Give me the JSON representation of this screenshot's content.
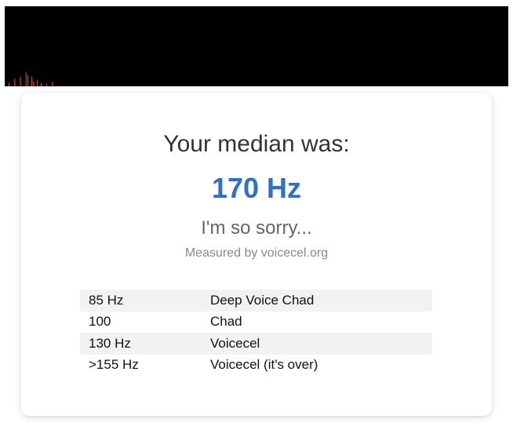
{
  "visualizer": {
    "bar_color": "#d0413a",
    "levels": [
      0.05,
      0.0,
      0.0,
      0.1,
      0.0,
      0.0,
      0.12,
      0.0,
      0.0,
      0.18,
      0.14,
      0.0,
      0.12,
      0.06,
      0.0,
      0.08,
      0.0,
      0.04,
      0.0,
      0.0,
      0.03,
      0.0,
      0.0,
      0.06
    ]
  },
  "result": {
    "headline": "Your median was:",
    "value": "170 Hz",
    "verdict": "I'm so sorry...",
    "credit": "Measured by voicecel.org",
    "value_color": "#2f6fc4"
  },
  "reference_table": [
    {
      "freq": "85 Hz",
      "label": "Deep Voice Chad"
    },
    {
      "freq": "100",
      "label": "Chad"
    },
    {
      "freq": "130 Hz",
      "label": "Voicecel"
    },
    {
      "freq": ">155 Hz",
      "label": "Voicecel (it's over)"
    }
  ]
}
